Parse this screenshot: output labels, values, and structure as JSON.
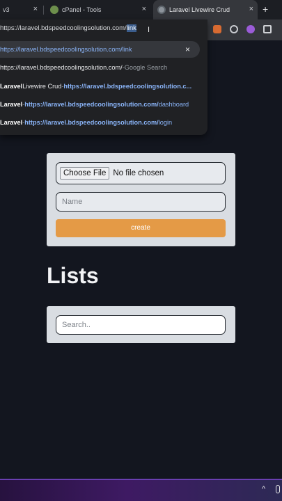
{
  "tabs": [
    {
      "title": "v3",
      "close": "×"
    },
    {
      "title": "cPanel - Tools",
      "close": "×"
    },
    {
      "title": "Laravel Livewire Crud",
      "close": "×"
    }
  ],
  "new_tab": "+",
  "omnibox": {
    "input_prefix": "https://laravel.bdspeedcoolingsolution.com/",
    "input_selected": "link",
    "suggestions": [
      {
        "url": "https://laravel.bdspeedcoolingsolution.com/link",
        "remove": "×"
      },
      {
        "url": "https://laravel.bdspeedcoolingsolution.com/",
        "sep": " - ",
        "hint": "Google Search"
      },
      {
        "title": "Laravel",
        "title_rest": " Livewire Crud",
        "sep": " - ",
        "url": "https://laravel.bdspeedcoolingsolution.c..."
      },
      {
        "title": "Laravel",
        "sep": " - ",
        "url_bold": "https://laravel.bdspeedcoolingsolution.com/",
        "url_rest": "dashboard"
      },
      {
        "title": "Laravel",
        "sep": " - ",
        "url_bold": "https://laravel.bdspeedcoolingsolution.com/",
        "url_rest": "login"
      }
    ]
  },
  "form": {
    "choose_file_label": "Choose File",
    "no_file_text": "No file chosen",
    "name_placeholder": "Name",
    "create_label": "create"
  },
  "lists_heading": "Lists",
  "search": {
    "placeholder": "Search.."
  },
  "colors": {
    "accent": "#e49a46",
    "page_bg": "#13161f",
    "card_bg": "#d9dde2",
    "link": "#8ab4f8"
  },
  "taskbar": {
    "chevron": "^"
  }
}
